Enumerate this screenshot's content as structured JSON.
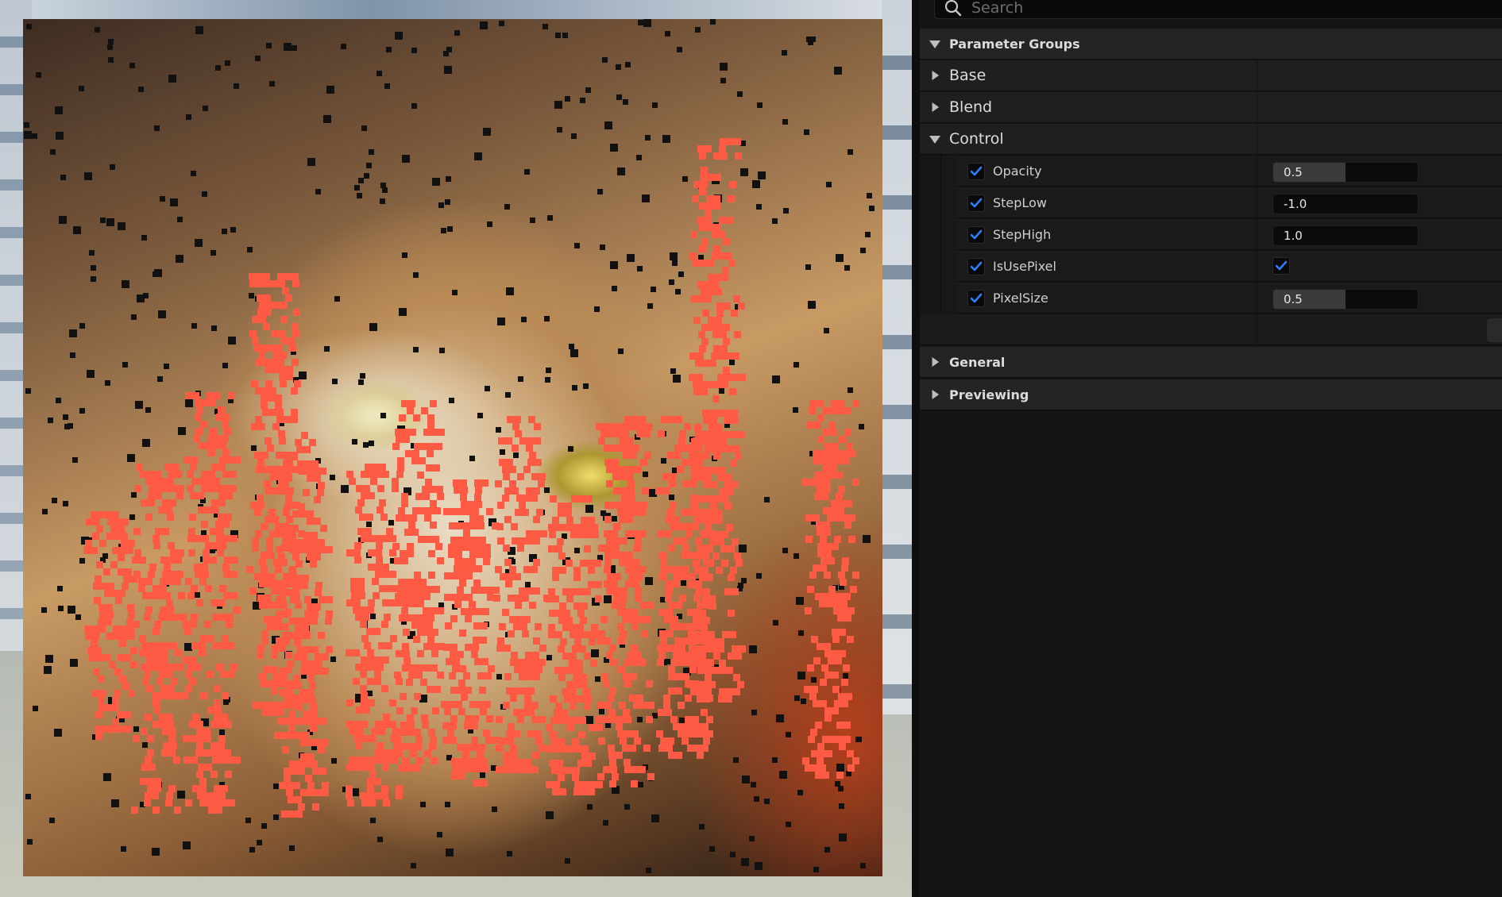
{
  "search": {
    "placeholder": "Search"
  },
  "parameter_groups_label": "Parameter Groups",
  "categories": [
    {
      "id": "base",
      "label": "Base",
      "expanded": false
    },
    {
      "id": "blend",
      "label": "Blend",
      "expanded": false
    },
    {
      "id": "control",
      "label": "Control",
      "expanded": true
    }
  ],
  "control_params": [
    {
      "name": "Opacity",
      "enabled": true,
      "type": "slider",
      "value": "0.5",
      "fill": 0.5
    },
    {
      "name": "StepLow",
      "enabled": true,
      "type": "number",
      "value": "-1.0"
    },
    {
      "name": "StepHigh",
      "enabled": true,
      "type": "number",
      "value": "1.0"
    },
    {
      "name": "IsUsePixel",
      "enabled": true,
      "type": "bool",
      "value": true
    },
    {
      "name": "PixelSize",
      "enabled": true,
      "type": "slider",
      "value": "0.5",
      "fill": 0.5
    }
  ],
  "sections": [
    {
      "id": "general",
      "label": "General"
    },
    {
      "id": "previewing",
      "label": "Previewing"
    }
  ],
  "colors": {
    "accent": "#2b7fff",
    "overlay": "#ff5a44",
    "panel_bg": "#151515"
  }
}
